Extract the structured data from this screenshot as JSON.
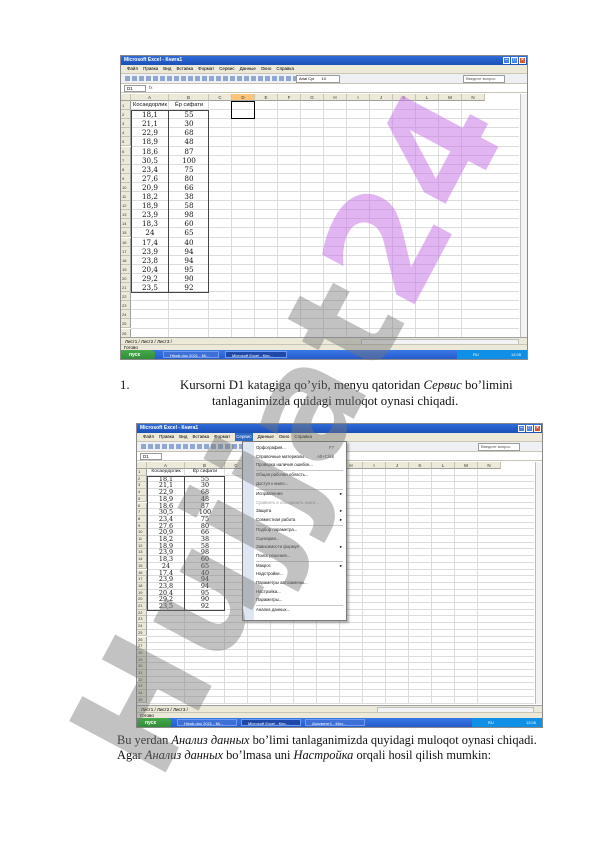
{
  "shot1": {
    "title": "Microsoft Excel - Книга1",
    "menus": [
      "Файл",
      "Правка",
      "Вид",
      "Вставка",
      "Формат",
      "Сервис",
      "Данные",
      "Окно",
      "Справка"
    ],
    "font_name": "Arial Cyr",
    "font_size": "10",
    "question_box": "Введите вопрос",
    "name_box": "D1",
    "fx": "fx",
    "columns": [
      "A",
      "B",
      "C",
      "D",
      "E",
      "F",
      "G",
      "H",
      "I",
      "J",
      "K",
      "L",
      "M",
      "N"
    ],
    "header_cells": [
      "Косаедорлик",
      "Ёр сифати"
    ],
    "rows": [
      [
        "18,1",
        "55"
      ],
      [
        "21,1",
        "30"
      ],
      [
        "22,9",
        "68"
      ],
      [
        "18,9",
        "48"
      ],
      [
        "18,6",
        "87"
      ],
      [
        "30,5",
        "100"
      ],
      [
        "23,4",
        "75"
      ],
      [
        "27,6",
        "80"
      ],
      [
        "20,9",
        "66"
      ],
      [
        "18,2",
        "38"
      ],
      [
        "18,9",
        "58"
      ],
      [
        "23,9",
        "98"
      ],
      [
        "18,3",
        "60"
      ],
      [
        "24",
        "65"
      ],
      [
        "17,4",
        "40"
      ],
      [
        "23,9",
        "94"
      ],
      [
        "23,8",
        "94"
      ],
      [
        "20,4",
        "95"
      ],
      [
        "29,2",
        "90"
      ],
      [
        "23,5",
        "92"
      ]
    ],
    "row_count": 26,
    "sheet_tabs": "Лист1 / Лист2 / Лист3 /",
    "status": "Готово",
    "taskbar_start": "пуск",
    "taskbar_tasks": [
      "Hisob-doc 2021 - Mi...",
      "Microsoft Excel - Кни..."
    ],
    "tray_lang": "RU",
    "tray_time": "12:05"
  },
  "caption": {
    "number": "1.",
    "before": "Kursorni D1 katagiga qo’yib, menyu qatoridan ",
    "italic": "Сервис",
    "after": " bo’limini",
    "line2": "tanlaganimizda quidagi muloqot oynasi chiqadi."
  },
  "shot2": {
    "title": "Microsoft Excel - Книга1",
    "menus": [
      "Файл",
      "Правка",
      "Вид",
      "Вставка",
      "Формат",
      "Сервис",
      "Данные",
      "Окно",
      "Справка"
    ],
    "question_box": "Введите вопрос",
    "name_box": "D1",
    "columns": [
      "A",
      "B",
      "C",
      "D",
      "E",
      "F",
      "G",
      "H",
      "I",
      "J",
      "K",
      "L",
      "M",
      "N"
    ],
    "header_cells": [
      "Косаедорлик",
      "Ёр сифати"
    ],
    "rows": [
      [
        "18,1",
        "55"
      ],
      [
        "21,1",
        "30"
      ],
      [
        "22,9",
        "68"
      ],
      [
        "18,9",
        "48"
      ],
      [
        "18,6",
        "87"
      ],
      [
        "30,5",
        "100"
      ],
      [
        "23,4",
        "75"
      ],
      [
        "27,6",
        "80"
      ],
      [
        "20,9",
        "66"
      ],
      [
        "18,2",
        "38"
      ],
      [
        "18,9",
        "58"
      ],
      [
        "23,9",
        "98"
      ],
      [
        "18,3",
        "60"
      ],
      [
        "24",
        "65"
      ],
      [
        "17,4",
        "40"
      ],
      [
        "23,9",
        "94"
      ],
      [
        "23,8",
        "94"
      ],
      [
        "20,4",
        "95"
      ],
      [
        "29,2",
        "90"
      ],
      [
        "23,5",
        "92"
      ]
    ],
    "row_count": 35,
    "menu_items": [
      {
        "label": "Орфография...",
        "shortcut": "F7"
      },
      {
        "label": "Справочные материалы...",
        "shortcut": "Alt+Click"
      },
      {
        "label": "Проверка наличия ошибок..."
      },
      {
        "label": "Общая рабочая область..."
      },
      {
        "label": "Доступ к книге..."
      },
      {
        "label": "Исправления",
        "arrow": true
      },
      {
        "label": "Сравнить и объединить книги...",
        "disabled": true
      },
      {
        "label": "Защита",
        "arrow": true
      },
      {
        "label": "Совместная работа",
        "arrow": true
      },
      {
        "label": "Подбор параметра..."
      },
      {
        "label": "Сценарии..."
      },
      {
        "label": "Зависимости формул",
        "arrow": true
      },
      {
        "label": "Поиск решения..."
      },
      {
        "label": "Макрос",
        "arrow": true
      },
      {
        "label": "Надстройки..."
      },
      {
        "label": "Параметры автозамены..."
      },
      {
        "label": "Настройка..."
      },
      {
        "label": "Параметры..."
      },
      {
        "label": "Анализ данных..."
      }
    ],
    "sheet_tabs": "Лист1 / Лист2 / Лист3 /",
    "status": "Готово",
    "taskbar_start": "пуск",
    "taskbar_tasks": [
      "Hisob-doc 2021 - Mi...",
      "Microsoft Excel - Кни...",
      "Документ1 - Micr..."
    ],
    "tray_lang": "RU",
    "tray_time": "12:06"
  },
  "paragraph": {
    "p1": "Bu yerdan ",
    "i1": "Анализ данных",
    "p2": "  bo’limi tanlaganimizda quyidagi muloqot oynasi chiqadi. Agar ",
    "i2": "Анализ данных",
    "p3": "  bo’lmasa uni ",
    "i3": "Настройка",
    "p4": " orqali hosil qilish mumkin:"
  },
  "watermark": {
    "prefix": "Hujjat",
    "accent": "24"
  },
  "colors": {
    "titlebar": "#2f6bd8",
    "selection_header": "#ffc67a",
    "menu_highlight": "#c1d2ee",
    "taskbar": "#2457c8",
    "start_button": "#2f8a36"
  }
}
